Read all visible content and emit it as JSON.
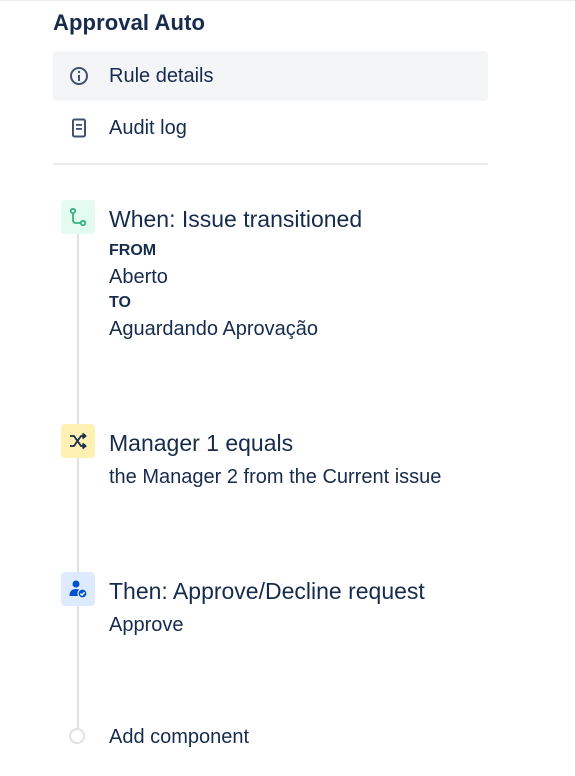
{
  "rule": {
    "title": "Approval Auto"
  },
  "nav": {
    "items": [
      {
        "label": "Rule details",
        "icon": "info-icon",
        "active": true
      },
      {
        "label": "Audit log",
        "icon": "document-icon",
        "active": false
      }
    ]
  },
  "components": [
    {
      "title": "When: Issue transitioned",
      "icon": "transition-icon",
      "icon_color": "#36b37e",
      "icon_bg": "#e3fcef",
      "from_label": "FROM",
      "from_value": "Aberto",
      "to_label": "TO",
      "to_value": "Aguardando Aprovação"
    },
    {
      "title": "Manager 1 equals",
      "icon": "shuffle-icon",
      "icon_color": "#172b4d",
      "icon_bg": "#fff0b3",
      "description": "the Manager 2 from the Current issue"
    },
    {
      "title": "Then: Approve/Decline request",
      "icon": "user-check-icon",
      "icon_color": "#0052cc",
      "icon_bg": "#deebff",
      "description": "Approve"
    }
  ],
  "add_component": {
    "label": "Add component"
  }
}
